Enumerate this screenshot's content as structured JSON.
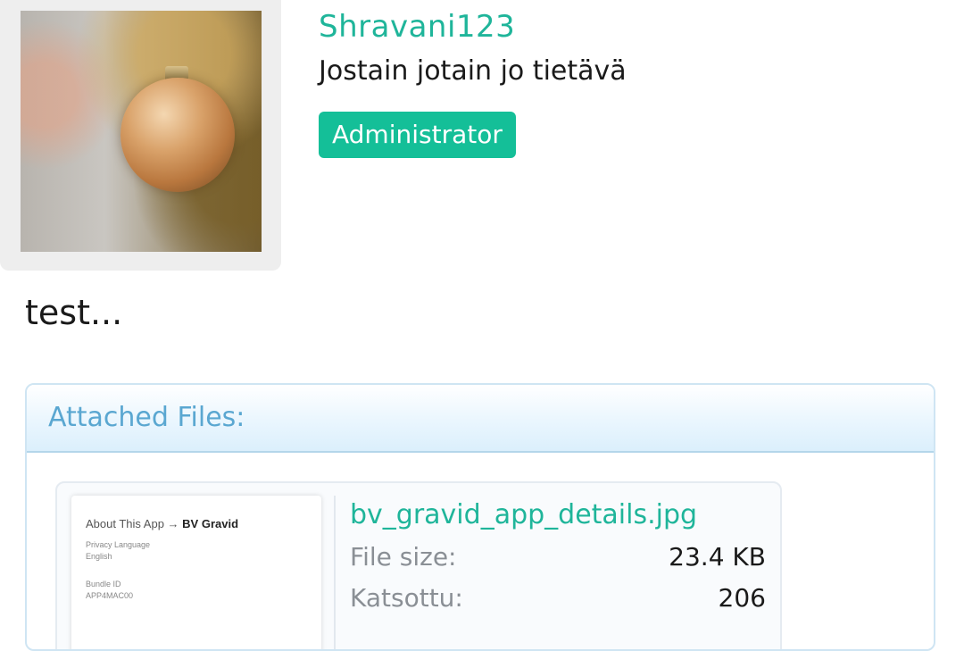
{
  "user": {
    "username": "Shravani123",
    "title": "Jostain jotain jo tietävä",
    "role": "Administrator"
  },
  "post": {
    "body": "test..."
  },
  "attachments": {
    "header": "Attached Files:",
    "files": [
      {
        "name": "bv_gravid_app_details.jpg",
        "size_label": "File size:",
        "size_value": "23.4 KB",
        "views_label": "Katsottu:",
        "views_value": "206",
        "thumbnail": {
          "title_prefix": "About This App →",
          "title_app": "BV Gravid",
          "line1": "Privacy Language",
          "line2": "English",
          "line3": "Bundle ID",
          "line4": "APP4MAC00"
        }
      }
    ]
  },
  "colors": {
    "accent": "#1fb59a",
    "badge": "#14bf98",
    "panel_title": "#5aa7d1",
    "panel_border": "#cfe5f3"
  }
}
